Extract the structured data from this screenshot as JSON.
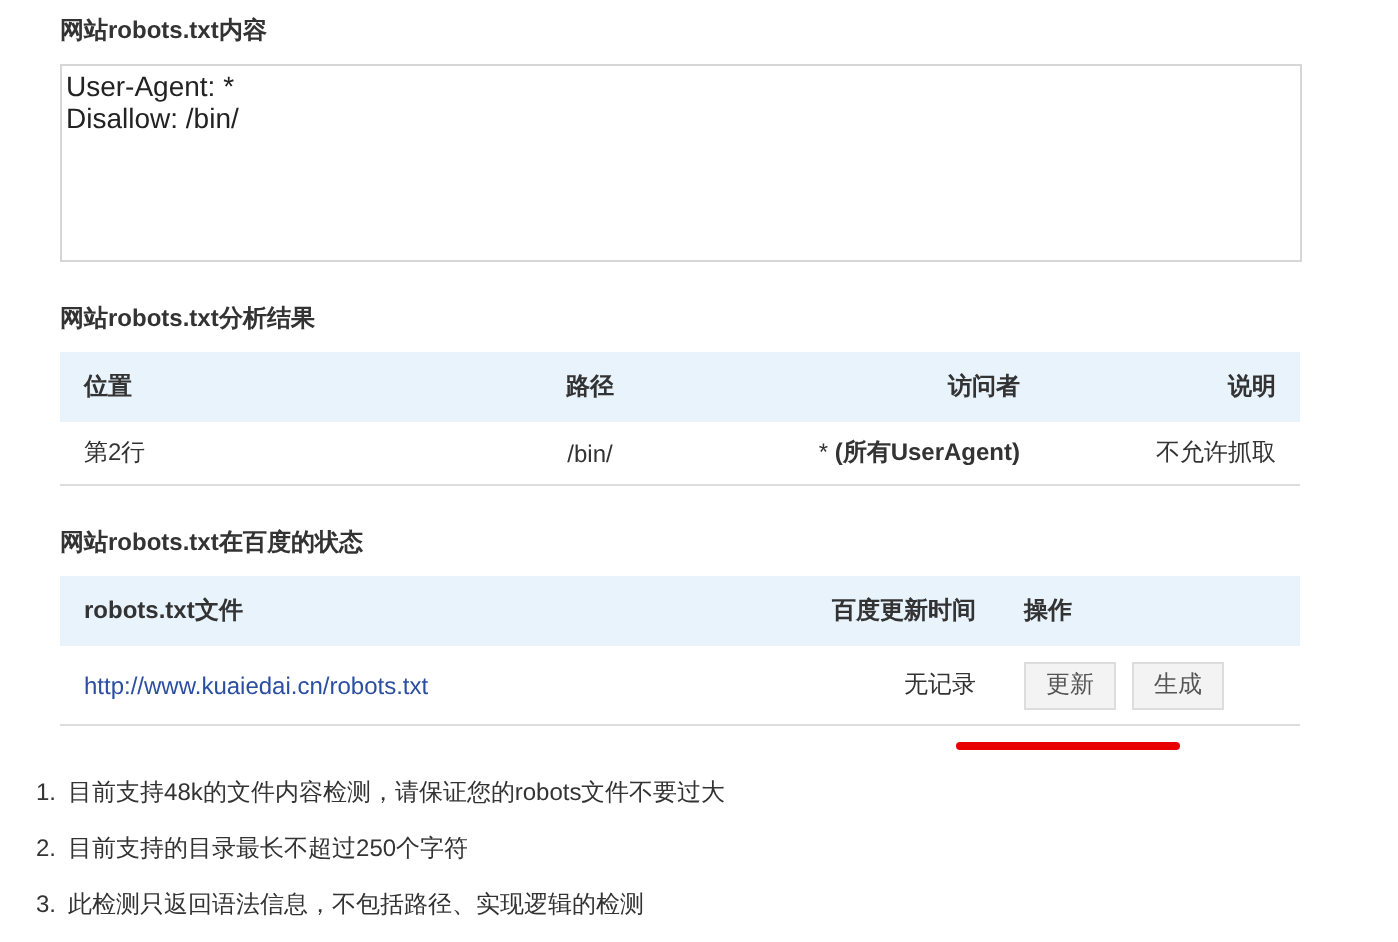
{
  "content_section": {
    "title": "网站robots.txt内容",
    "textarea_lines": [
      "User-Agent: *",
      "Disallow: /bin/"
    ]
  },
  "analysis_section": {
    "title": "网站robots.txt分析结果",
    "columns": [
      "位置",
      "路径",
      "访问者",
      "说明"
    ],
    "rows": [
      {
        "cells": [
          "第2行",
          "/bin/",
          "* **(所有UserAgent)**",
          "不允许抓取"
        ]
      }
    ]
  },
  "status_section": {
    "title": "网站robots.txt在百度的状态",
    "columns": [
      "robots.txt文件",
      "百度更新时间",
      "操作"
    ],
    "rows": [
      {
        "link": "http://www.kuaiedai.cn/robots.txt",
        "update_time": "无记录",
        "buttons": [
          "更新",
          "生成"
        ]
      }
    ]
  },
  "notes": [
    {
      "number": "1.",
      "text": "目前支持48k的文件内容检测，请保证您的robots文件不要过大"
    },
    {
      "number": "2.",
      "text": "目前支持的目录最长不超过250个字符"
    },
    {
      "number": "3.",
      "text": "此检测只返回语法信息，不包括路径、实现逻辑的检测"
    }
  ]
}
